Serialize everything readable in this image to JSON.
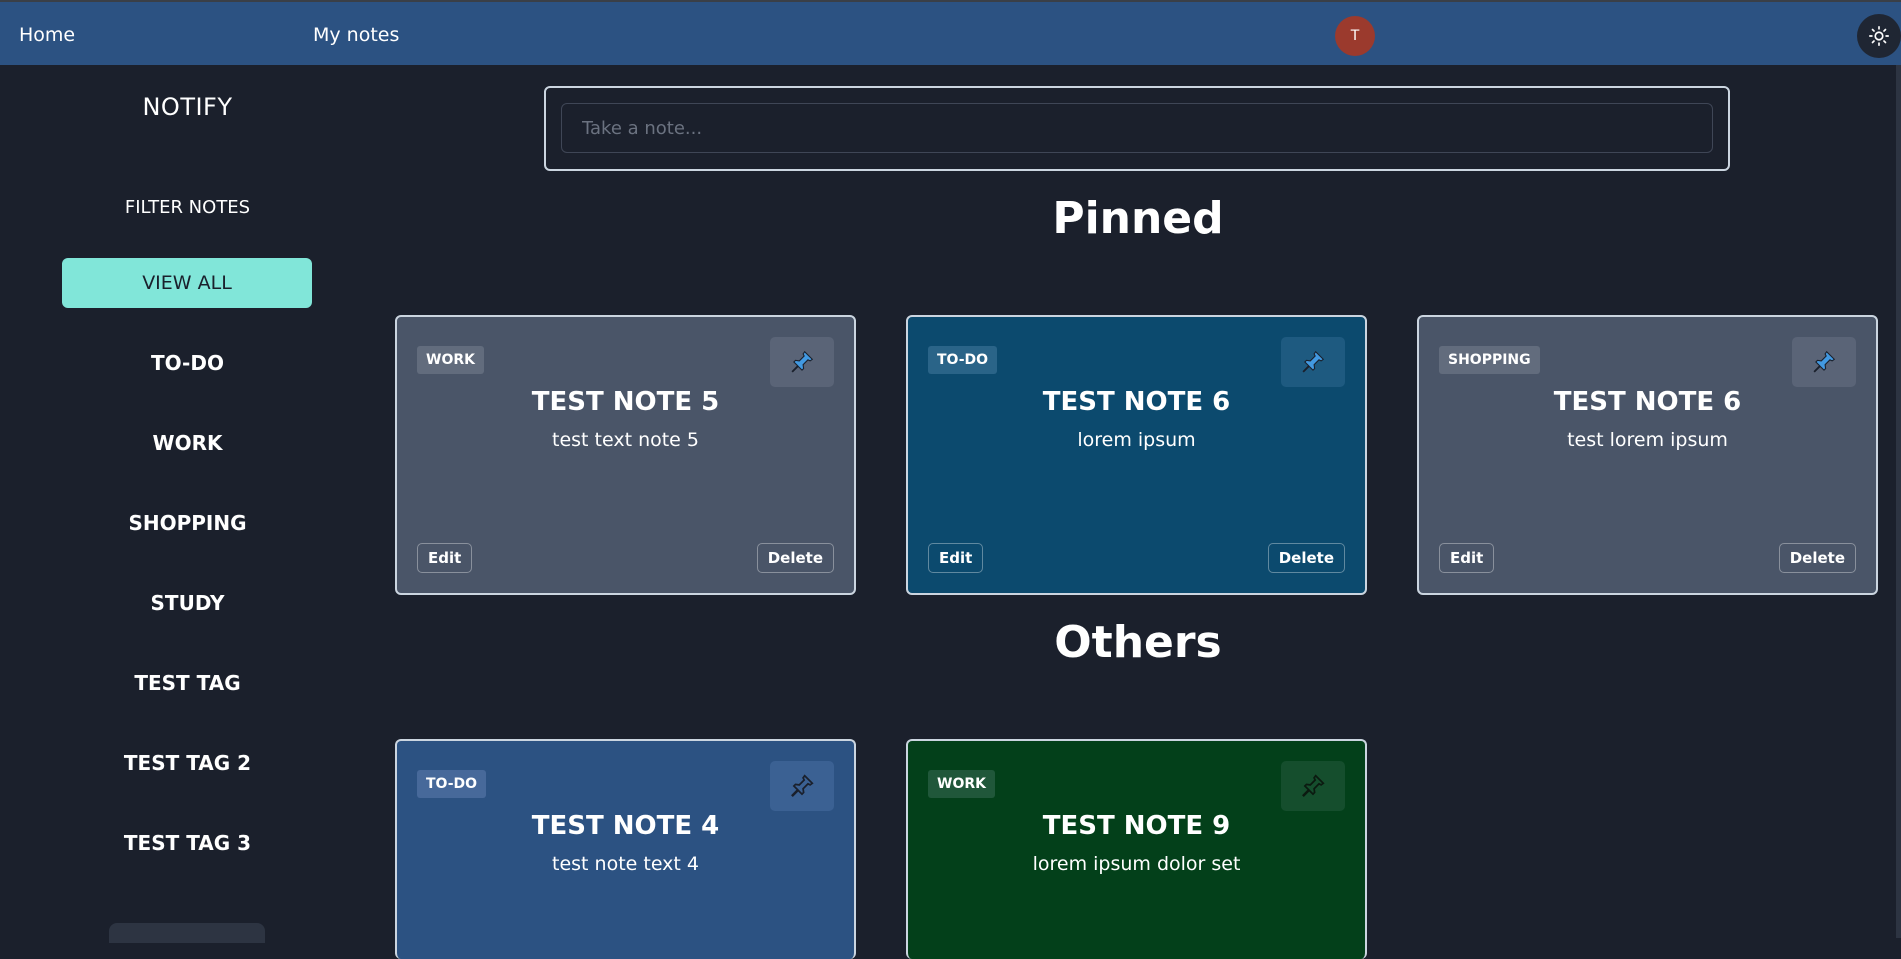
{
  "nav": {
    "home": "Home",
    "my_notes": "My notes",
    "avatar_initial": "T",
    "theme_icon": "sun-icon"
  },
  "sidebar": {
    "brand": "NOTIFY",
    "filter_title": "FILTER NOTES",
    "view_all": "VIEW ALL",
    "tags": [
      "TO-DO",
      "WORK",
      "SHOPPING",
      "STUDY",
      "TEST TAG",
      "TEST TAG 2",
      "TEST TAG 3"
    ]
  },
  "composer": {
    "placeholder": "Take a note..."
  },
  "sections": {
    "pinned": "Pinned",
    "others": "Others"
  },
  "pinned_notes": [
    {
      "tag": "WORK",
      "title": "TEST NOTE 5",
      "text": "test text note 5",
      "edit": "Edit",
      "delete": "Delete",
      "pinned": true,
      "color": "#4a5568"
    },
    {
      "tag": "TO-DO",
      "title": "TEST NOTE 6",
      "text": "lorem ipsum",
      "edit": "Edit",
      "delete": "Delete",
      "pinned": true,
      "color": "#0c4a6e"
    },
    {
      "tag": "SHOPPING",
      "title": "TEST NOTE 6",
      "text": "test lorem ipsum",
      "edit": "Edit",
      "delete": "Delete",
      "pinned": true,
      "color": "#4a5568"
    }
  ],
  "other_notes": [
    {
      "tag": "TO-DO",
      "title": "TEST NOTE 4",
      "text": "test note text 4",
      "pinned": false,
      "color": "#2c5282"
    },
    {
      "tag": "WORK",
      "title": "TEST NOTE 9",
      "text": "lorem ipsum dolor set",
      "pinned": false,
      "color": "#03401a"
    }
  ],
  "colors": {
    "topbar": "#2c5282",
    "background": "#1b202c",
    "accent": "#81e6d9",
    "pin_active": "#4299e1"
  }
}
